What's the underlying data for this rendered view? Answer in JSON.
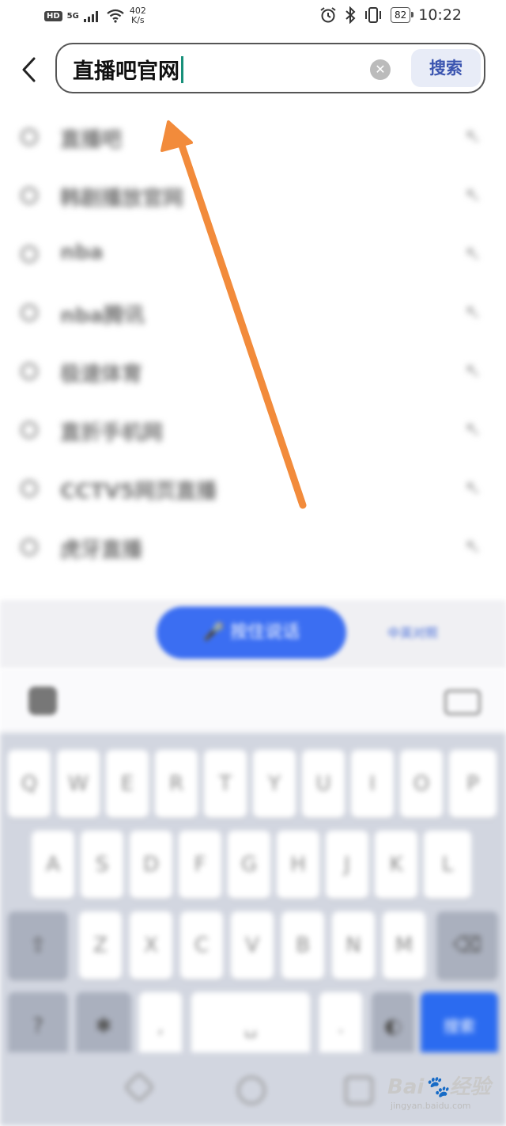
{
  "status_bar": {
    "hd": "HD",
    "signal": "5G",
    "net_speed_value": "402",
    "net_speed_unit": "K/s",
    "battery": "82",
    "time": "10:22"
  },
  "search": {
    "query": "直播吧官网",
    "button_label": "搜索"
  },
  "suggestions": [
    {
      "text": "直播吧"
    },
    {
      "text": "韩剧播放官网"
    },
    {
      "text": "nba"
    },
    {
      "text": "nba腾讯"
    },
    {
      "text": "极速体育"
    },
    {
      "text": "直折手机网"
    },
    {
      "text": "CCTV5网页直播"
    },
    {
      "text": "虎牙直播"
    }
  ],
  "voice": {
    "button_label": "按住说话",
    "side_label": "中英对照"
  },
  "keyboard": {
    "row1": [
      "Q",
      "W",
      "E",
      "R",
      "T",
      "Y",
      "U",
      "I",
      "O",
      "P"
    ],
    "row2": [
      "A",
      "S",
      "D",
      "F",
      "G",
      "H",
      "J",
      "K",
      "L"
    ],
    "row3": [
      "Z",
      "X",
      "C",
      "V",
      "B",
      "N",
      "M"
    ],
    "enter_label": "搜索"
  },
  "watermark": {
    "title": "Bai🐾经验",
    "url": "jingyan.baidu.com"
  },
  "colors": {
    "accent": "#3b6ef2",
    "arrow": "#f28b3b",
    "cursor": "#18907a"
  }
}
